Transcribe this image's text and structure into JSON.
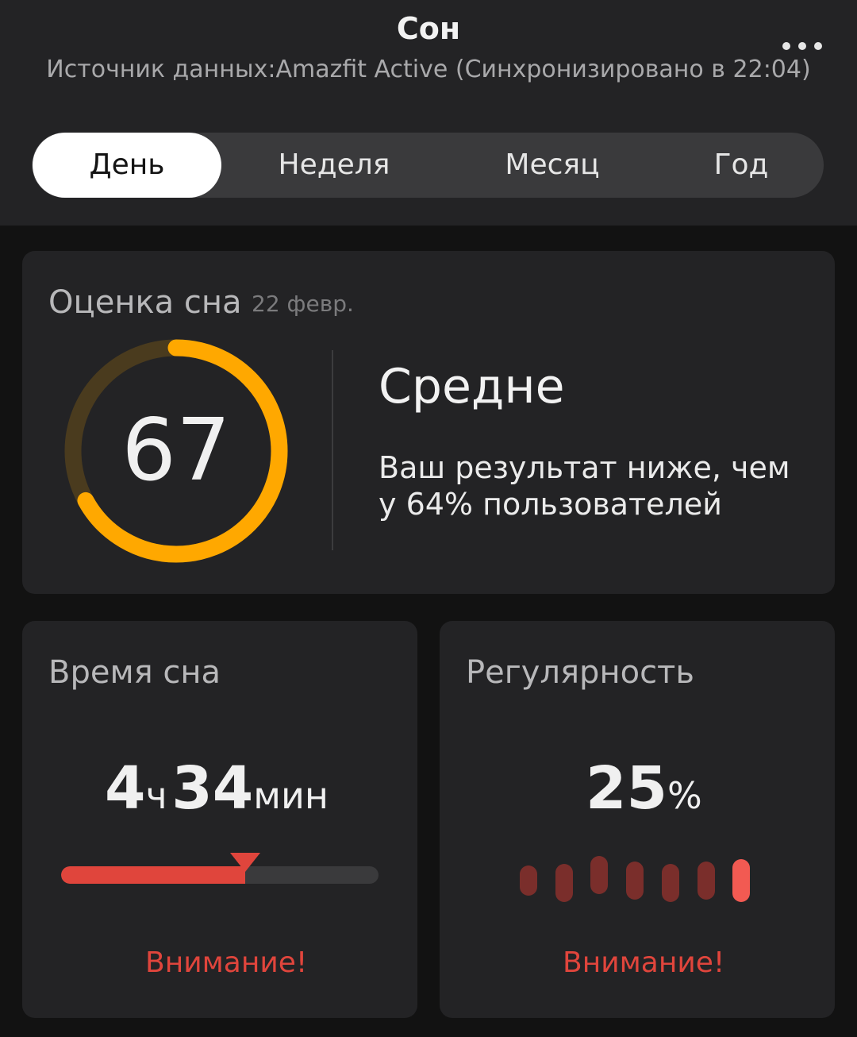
{
  "header": {
    "title": "Сон",
    "subtitle": "Источник данных:Amazfit Active (Синхронизировано в 22:04)",
    "more_icon": "more-horizontal-icon"
  },
  "tabs": [
    {
      "label": "День",
      "active": true
    },
    {
      "label": "Неделя",
      "active": false
    },
    {
      "label": "Месяц",
      "active": false
    },
    {
      "label": "Год",
      "active": false
    }
  ],
  "score_card": {
    "title": "Оценка сна",
    "date": "22 февр.",
    "score": "67",
    "score_fraction": 0.67,
    "rating": "Средне",
    "comparison": "Ваш результат ниже, чем у 64% пользователей",
    "colors": {
      "ring": "#FFA800",
      "ring_track": "#4A3B1E"
    }
  },
  "sleep_time_card": {
    "title": "Время сна",
    "hours": "4",
    "hours_unit": "ч",
    "minutes": "34",
    "minutes_unit": "мин",
    "progress_fraction": 0.58,
    "status": "Внимание!",
    "colors": {
      "fill": "#E0453C",
      "track": "#3A3A3C"
    }
  },
  "regularity_card": {
    "title": "Регулярность",
    "value": "25",
    "unit": "%",
    "status": "Внимание!",
    "pill_levels": [
      0.5,
      0.35,
      0.7,
      0.5,
      0.35,
      0.5,
      0.5
    ],
    "colors": {
      "pill": "#7A2E2B",
      "pill_active": "#F25A52"
    }
  }
}
